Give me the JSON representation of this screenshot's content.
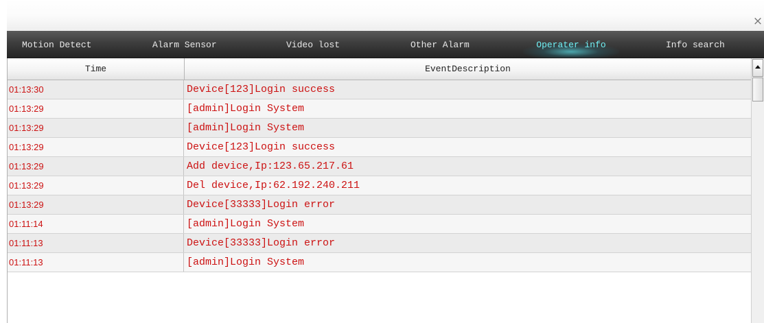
{
  "window": {
    "close_glyph": "×"
  },
  "tabs": [
    {
      "label": "Motion Detect",
      "active": false
    },
    {
      "label": "Alarm Sensor",
      "active": false
    },
    {
      "label": "Video lost",
      "active": false
    },
    {
      "label": "Other Alarm",
      "active": false
    },
    {
      "label": "Operater info",
      "active": true
    },
    {
      "label": "Info search",
      "active": false
    }
  ],
  "table": {
    "columns": [
      "Time",
      "EventDescription"
    ],
    "rows": [
      {
        "time": "01:13:30",
        "desc": "Device[123]Login success"
      },
      {
        "time": "01:13:29",
        "desc": "[admin]Login System"
      },
      {
        "time": "01:13:29",
        "desc": "[admin]Login System"
      },
      {
        "time": "01:13:29",
        "desc": "Device[123]Login success"
      },
      {
        "time": "01:13:29",
        "desc": "Add device,Ip:123.65.217.61"
      },
      {
        "time": "01:13:29",
        "desc": "Del device,Ip:62.192.240.211"
      },
      {
        "time": "01:13:29",
        "desc": "Device[33333]Login error"
      },
      {
        "time": "01:11:14",
        "desc": "[admin]Login System"
      },
      {
        "time": "01:11:13",
        "desc": "Device[33333]Login error"
      },
      {
        "time": "01:11:13",
        "desc": "[admin]Login System"
      }
    ]
  },
  "colors": {
    "event_text": "#cc1111",
    "active_tab": "#6ff0f5"
  }
}
